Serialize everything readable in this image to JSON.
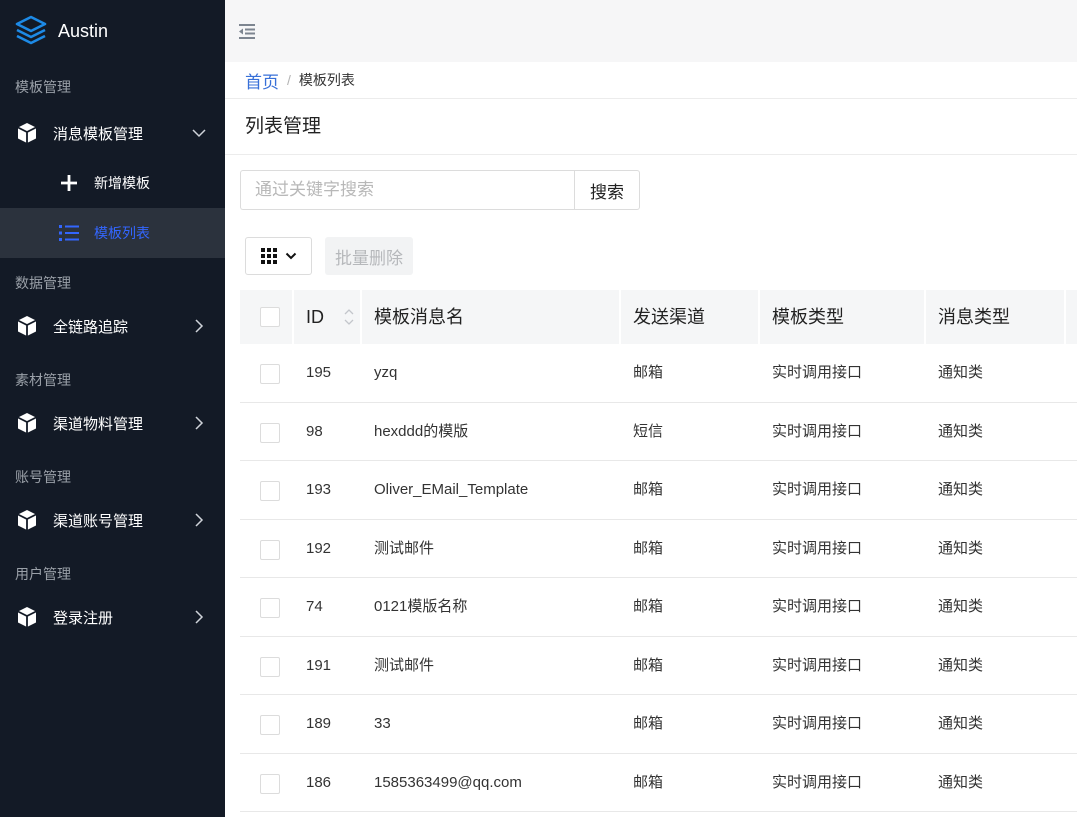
{
  "app": {
    "name": "Austin"
  },
  "sidebar": {
    "groups": [
      {
        "title": "模板管理"
      },
      {
        "title": "数据管理"
      },
      {
        "title": "素材管理"
      },
      {
        "title": "账号管理"
      },
      {
        "title": "用户管理"
      }
    ],
    "items": {
      "template_mgmt": "消息模板管理",
      "new_template": "新增模板",
      "template_list": "模板列表",
      "trace": "全链路追踪",
      "material": "渠道物料管理",
      "account": "渠道账号管理",
      "login": "登录注册"
    }
  },
  "breadcrumb": {
    "home": "首页",
    "separator": "/",
    "current": "模板列表"
  },
  "page_title": "列表管理",
  "search": {
    "placeholder": "通过关键字搜索",
    "value": "",
    "button": "搜索"
  },
  "toolbar": {
    "batch_delete": "批量删除"
  },
  "table": {
    "columns": [
      "ID",
      "模板消息名",
      "发送渠道",
      "模板类型",
      "消息类型"
    ],
    "rows": [
      {
        "id": "195",
        "name": "yzq",
        "channel": "邮箱",
        "type": "实时调用接口",
        "msg_type": "通知类"
      },
      {
        "id": "98",
        "name": "hexddd的模版",
        "channel": "短信",
        "type": "实时调用接口",
        "msg_type": "通知类"
      },
      {
        "id": "193",
        "name": "Oliver_EMail_Template",
        "channel": "邮箱",
        "type": "实时调用接口",
        "msg_type": "通知类"
      },
      {
        "id": "192",
        "name": "测试邮件",
        "channel": "邮箱",
        "type": "实时调用接口",
        "msg_type": "通知类"
      },
      {
        "id": "74",
        "name": "0121模版名称",
        "channel": "邮箱",
        "type": "实时调用接口",
        "msg_type": "通知类"
      },
      {
        "id": "191",
        "name": "测试邮件",
        "channel": "邮箱",
        "type": "实时调用接口",
        "msg_type": "通知类"
      },
      {
        "id": "189",
        "name": "33",
        "channel": "邮箱",
        "type": "实时调用接口",
        "msg_type": "通知类"
      },
      {
        "id": "186",
        "name": "1585363499@qq.com",
        "channel": "邮箱",
        "type": "实时调用接口",
        "msg_type": "通知类"
      }
    ]
  },
  "colors": {
    "sidebar_bg": "#131a26",
    "active_bg": "#2b323d",
    "accent": "#3366ff",
    "logo": "#1d8ae6"
  },
  "icons": [
    "logo-icon",
    "cube-icon",
    "chevron-down-icon",
    "chevron-right-icon",
    "plus-icon",
    "list-icon",
    "menu-fold-icon",
    "grid-icon",
    "sort-icon"
  ]
}
